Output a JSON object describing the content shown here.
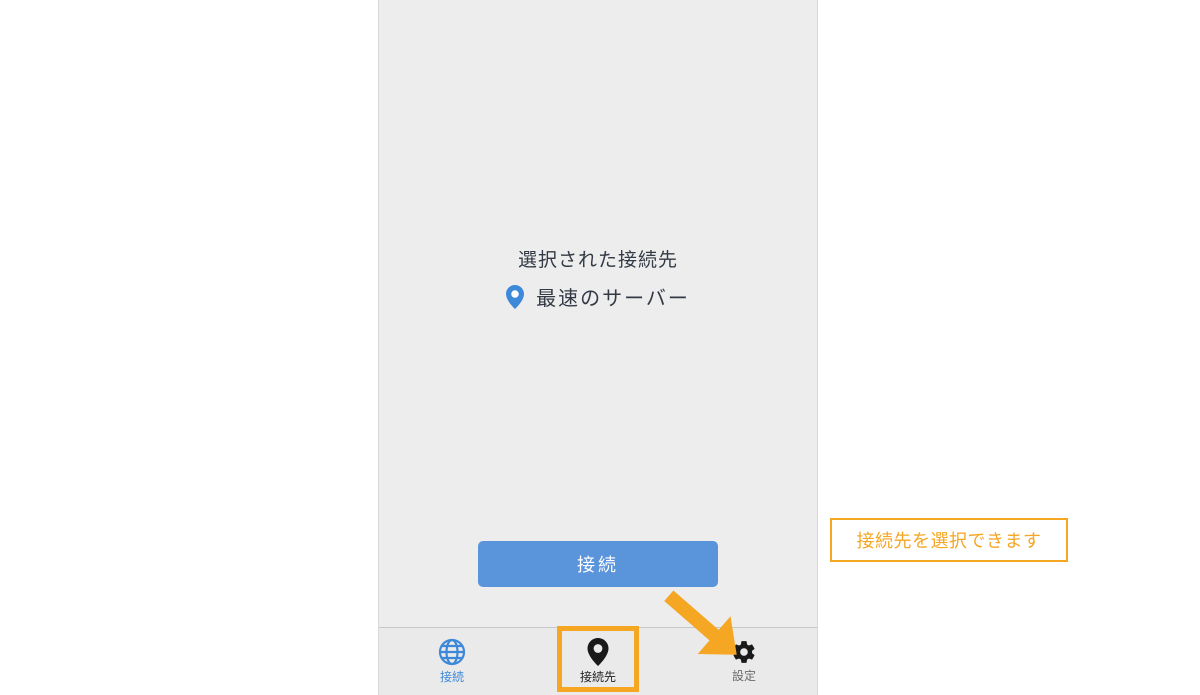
{
  "main": {
    "selected_label": "選択された接続先",
    "server_name": "最速のサーバー",
    "connect_button": "接続"
  },
  "tabs": {
    "connect": "接続",
    "destination": "接続先",
    "settings": "設定"
  },
  "callout": {
    "text": "接続先を選択できます"
  }
}
